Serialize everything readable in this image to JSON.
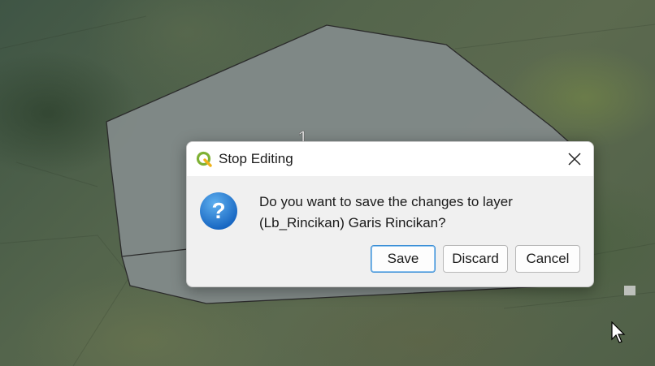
{
  "map": {
    "feature_label": "1"
  },
  "dialog": {
    "title": "Stop Editing",
    "message_line1": "Do you want to save the changes to layer",
    "message_line2": "(Lb_Rincikan) Garis Rincikan?",
    "buttons": {
      "save": "Save",
      "discard": "Discard",
      "cancel": "Cancel"
    },
    "icons": {
      "app": "qgis-icon",
      "close": "close-icon",
      "message": "question-icon"
    }
  },
  "colors": {
    "polygon_fill": "#828a89",
    "question_icon": "#2a7fd0",
    "default_button_border": "#3d8fd6",
    "qgis_green": "#7fb135"
  }
}
